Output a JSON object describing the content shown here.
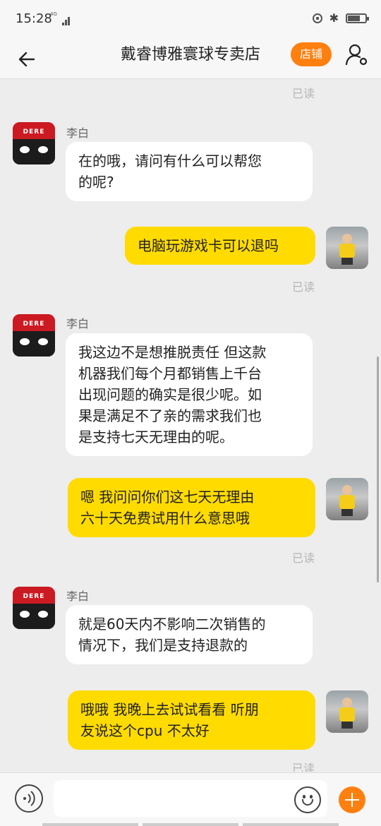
{
  "status_bar": {
    "time": "15:28",
    "network": "4G",
    "battery_level": 0.7
  },
  "header": {
    "title": "戴睿博雅寰球专卖店",
    "store_label": "店铺"
  },
  "chat": {
    "top_read": "已读",
    "messages": [
      {
        "side": "left",
        "sender": "李白",
        "lines": [
          "在的哦，请问有什么可以帮您",
          "的呢?"
        ]
      },
      {
        "side": "right",
        "lines": [
          "电脑玩游戏卡可以退吗"
        ],
        "status": "已读"
      },
      {
        "side": "left",
        "sender": "李白",
        "lines": [
          "我这边不是想推脱责任 但这款",
          "机器我们每个月都销售上千台",
          "出现问题的确实是很少呢。如",
          "果是满足不了亲的需求我们也",
          "是支持七天无理由的呢。"
        ]
      },
      {
        "side": "right",
        "lines": [
          "嗯 我问问你们这七天无理由",
          "六十天免费试用什么意思哦"
        ],
        "status": "已读"
      },
      {
        "side": "left",
        "sender": "李白",
        "lines": [
          "就是60天内不影响二次销售的",
          "情况下，我们是支持退款的"
        ]
      },
      {
        "side": "right",
        "lines": [
          "哦哦  我晚上去试试看看  听朋",
          "友说这个cpu 不太好"
        ],
        "status": "已读"
      }
    ]
  },
  "composer": {
    "placeholder": ""
  },
  "icons": {
    "back": "arrow-left-icon",
    "profile": "user-gear-icon",
    "voice": "voice-icon",
    "emoji": "emoji-icon",
    "plus": "plus-icon",
    "bluetooth": "bluetooth-icon",
    "lock": "rotation-lock-icon",
    "battery": "battery-icon"
  },
  "colors": {
    "accent": "#ff7f0f",
    "user_bubble": "#ffdb00",
    "shop_bubble": "#ffffff",
    "background": "#ededed"
  }
}
